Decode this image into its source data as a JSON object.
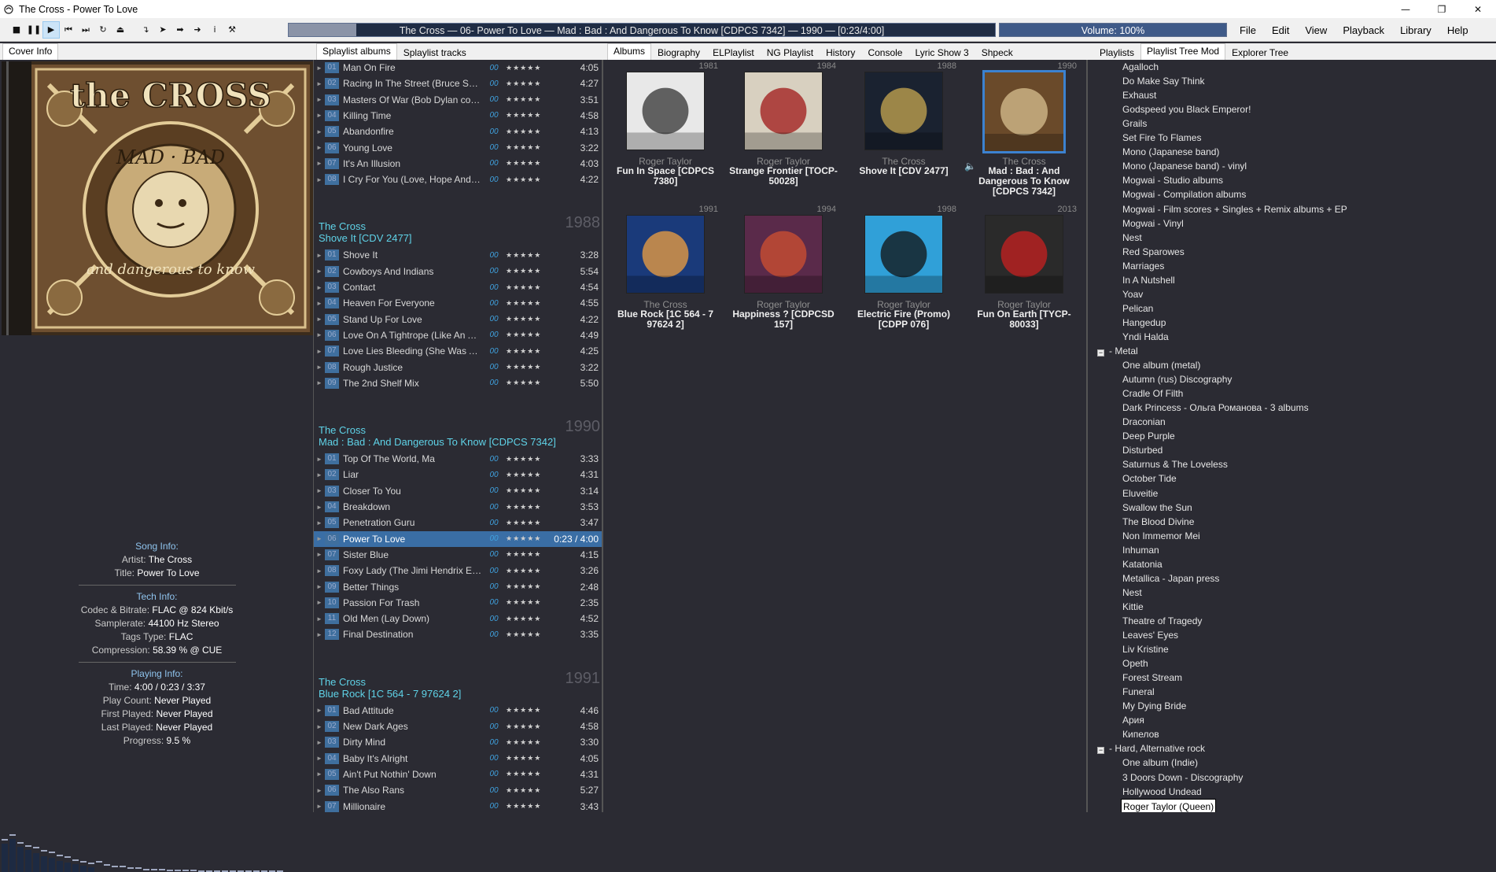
{
  "window": {
    "title": "The Cross - Power To Love"
  },
  "toolbar": {
    "buttons": [
      "stop",
      "pause",
      "play",
      "prev",
      "next",
      "random",
      "eject",
      "a",
      "b",
      "c",
      "d",
      "info",
      "tools"
    ]
  },
  "nowplaying": {
    "text": "The Cross    — 06- Power To Love —    Mad : Bad : And Dangerous To Know [CDPCS 7342] — 1990 —    [0:23/4:00]",
    "progress": 0.096
  },
  "volume": {
    "text": "Volume: 100%",
    "level": 1.0
  },
  "menu": [
    "File",
    "Edit",
    "View",
    "Playback",
    "Library",
    "Help"
  ],
  "left_tabs": [
    "Cover Info"
  ],
  "playlist_tabs": [
    "Splaylist albums",
    "Splaylist tracks"
  ],
  "album_tabs": [
    "Albums",
    "Biography",
    "ELPlaylist",
    "NG Playlist",
    "History",
    "Console",
    "Lyric Show 3",
    "Shpeck"
  ],
  "tree_tabs": [
    "Playlists",
    "Playlist Tree Mod",
    "Explorer Tree"
  ],
  "cover": {
    "band": "the CROSS",
    "subtitle_1": "MAD · BAD",
    "subtitle_2": "and dangerous to know"
  },
  "songinfo": {
    "song_header": "Song Info:",
    "artist_label": "Artist:",
    "artist": "The Cross",
    "title_label": "Title:",
    "title": "Power To Love",
    "tech_header": "Tech Info:",
    "codec_label": "Codec & Bitrate:",
    "codec": "FLAC @ 824 Kbit/s",
    "samplerate_label": "Samplerate:",
    "samplerate": "44100 Hz Stereo",
    "tags_label": "Tags Type:",
    "tags": "FLAC",
    "compression_label": "Compression:",
    "compression": "58.39 % @ CUE",
    "playing_header": "Playing Info:",
    "time_label": "Time:",
    "time": "4:00 / 0:23 / 3:37",
    "playcount_label": "Play Count:",
    "playcount": "Never Played",
    "first_label": "First Played:",
    "first": "Never Played",
    "last_label": "Last Played:",
    "last": "Never Played",
    "progress_label": "Progress:",
    "progress": "9.5 %"
  },
  "playlist": {
    "rating": "★★★★★",
    "oo": "00",
    "groups": [
      {
        "artist": "",
        "album": "",
        "year": "",
        "tracks": [
          {
            "n": "01",
            "t": "Man On Fire",
            "d": "4:05"
          },
          {
            "n": "02",
            "t": "Racing In The Street (Bruce Spri...",
            "d": "4:27"
          },
          {
            "n": "03",
            "t": "Masters Of War (Bob Dylan cover)",
            "d": "3:51"
          },
          {
            "n": "04",
            "t": "Killing Time",
            "d": "4:58"
          },
          {
            "n": "05",
            "t": "Abandonfire",
            "d": "4:13"
          },
          {
            "n": "06",
            "t": "Young Love",
            "d": "3:22"
          },
          {
            "n": "07",
            "t": "It's An Illusion",
            "d": "4:03"
          },
          {
            "n": "08",
            "t": "I Cry For You (Love, Hope And C...",
            "d": "4:22"
          }
        ]
      },
      {
        "artist": "The Cross",
        "album": "Shove It [CDV 2477]",
        "year": "1988",
        "tracks": [
          {
            "n": "01",
            "t": "Shove It",
            "d": "3:28"
          },
          {
            "n": "02",
            "t": "Cowboys And Indians",
            "d": "5:54"
          },
          {
            "n": "03",
            "t": "Contact",
            "d": "4:54"
          },
          {
            "n": "04",
            "t": "Heaven For Everyone",
            "d": "4:55"
          },
          {
            "n": "05",
            "t": "Stand Up For Love",
            "d": "4:22"
          },
          {
            "n": "06",
            "t": "Love On A Tightrope (Like An An...",
            "d": "4:49"
          },
          {
            "n": "07",
            "t": "Love Lies Bleeding (She Was A...",
            "d": "4:25"
          },
          {
            "n": "08",
            "t": "Rough Justice",
            "d": "3:22"
          },
          {
            "n": "09",
            "t": "The 2nd Shelf Mix",
            "d": "5:50"
          }
        ]
      },
      {
        "artist": "The Cross",
        "album": "Mad : Bad : And Dangerous To Know [CDPCS 7342]",
        "year": "1990",
        "tracks": [
          {
            "n": "01",
            "t": "Top Of The World, Ma",
            "d": "3:33"
          },
          {
            "n": "02",
            "t": "Liar",
            "d": "4:31"
          },
          {
            "n": "03",
            "t": "Closer To You",
            "d": "3:14"
          },
          {
            "n": "04",
            "t": "Breakdown",
            "d": "3:53"
          },
          {
            "n": "05",
            "t": "Penetration Guru",
            "d": "3:47"
          },
          {
            "n": "06",
            "t": "Power To Love",
            "d": "0:23 / 4:00",
            "sel": true
          },
          {
            "n": "07",
            "t": "Sister Blue",
            "d": "4:15"
          },
          {
            "n": "08",
            "t": "Foxy Lady (The Jimi Hendrix Exp...",
            "d": "3:26"
          },
          {
            "n": "09",
            "t": "Better Things",
            "d": "2:48"
          },
          {
            "n": "10",
            "t": "Passion For Trash",
            "d": "2:35"
          },
          {
            "n": "11",
            "t": "Old Men (Lay Down)",
            "d": "4:52"
          },
          {
            "n": "12",
            "t": "Final Destination",
            "d": "3:35"
          }
        ]
      },
      {
        "artist": "The Cross",
        "album": "Blue Rock [1C 564 - 7 97624 2]",
        "year": "1991",
        "tracks": [
          {
            "n": "01",
            "t": "Bad Attitude",
            "d": "4:46"
          },
          {
            "n": "02",
            "t": "New Dark Ages",
            "d": "4:58"
          },
          {
            "n": "03",
            "t": "Dirty Mind",
            "d": "3:30"
          },
          {
            "n": "04",
            "t": "Baby It's Alright",
            "d": "4:05"
          },
          {
            "n": "05",
            "t": "Ain't Put Nothin' Down",
            "d": "4:31"
          },
          {
            "n": "06",
            "t": "The Also Rans",
            "d": "5:27"
          },
          {
            "n": "07",
            "t": "Millionaire",
            "d": "3:43"
          }
        ]
      }
    ]
  },
  "albums": [
    {
      "year": "1981",
      "artist": "Roger Taylor",
      "name": "Fun In Space [CDPCS 7380]",
      "color": "#e8e8e8",
      "accent": "#333"
    },
    {
      "year": "1984",
      "artist": "Roger Taylor",
      "name": "Strange Frontier [TOCP-50028]",
      "color": "#d8d0c0",
      "accent": "#a01818"
    },
    {
      "year": "1988",
      "artist": "The Cross",
      "name": "Shove It [CDV 2477]",
      "color": "#1a2230",
      "accent": "#c8a850"
    },
    {
      "year": "1990",
      "artist": "The Cross",
      "name": "Mad : Bad : And Dangerous To Know [CDPCS 7342]",
      "color": "#6a4a2a",
      "accent": "#d8c090",
      "sel": true
    },
    {
      "year": "1991",
      "artist": "The Cross",
      "name": "Blue Rock [1C 564 - 7 97624 2]",
      "color": "#1a3a7a",
      "accent": "#f0a040"
    },
    {
      "year": "1994",
      "artist": "Roger Taylor",
      "name": "Happiness ? [CDPCSD 157]",
      "color": "#5a2a4a",
      "accent": "#d05030"
    },
    {
      "year": "1998",
      "artist": "Roger Taylor",
      "name": "Electric Fire (Promo) [CDPP 076]",
      "color": "#30a0d8",
      "accent": "#111"
    },
    {
      "year": "2013",
      "artist": "Roger Taylor",
      "name": "Fun On Earth [TYCP-80033]",
      "color": "#2a2a2a",
      "accent": "#c82020"
    }
  ],
  "tree": [
    {
      "t": "Agalloch"
    },
    {
      "t": "Do Make Say Think"
    },
    {
      "t": "Exhaust"
    },
    {
      "t": "Godspeed you Black Emperor!"
    },
    {
      "t": "Grails"
    },
    {
      "t": "Set Fire To Flames"
    },
    {
      "t": "Mono (Japanese band)"
    },
    {
      "t": "Mono (Japanese band) - vinyl"
    },
    {
      "t": "Mogwai - Studio albums"
    },
    {
      "t": "Mogwai - Compilation albums"
    },
    {
      "t": "Mogwai - Film scores + Singles + Remix albums + EP"
    },
    {
      "t": "Mogwai - Vinyl"
    },
    {
      "t": "Nest"
    },
    {
      "t": "Red Sparowes"
    },
    {
      "t": "Marriages"
    },
    {
      "t": "In A Nutshell"
    },
    {
      "t": "Yoav"
    },
    {
      "t": "Pelican"
    },
    {
      "t": "Hangedup"
    },
    {
      "t": "Yndi Halda"
    },
    {
      "t": "- Metal",
      "cat": true
    },
    {
      "t": "One album (metal)"
    },
    {
      "t": "Autumn (rus) Discography"
    },
    {
      "t": "Cradle Of Filth"
    },
    {
      "t": "Dark Princess  -  Ольга Романова  -  3 albums"
    },
    {
      "t": "Draconian"
    },
    {
      "t": "Deep Purple"
    },
    {
      "t": "Disturbed"
    },
    {
      "t": "Saturnus  &  The Loveless"
    },
    {
      "t": "October Tide"
    },
    {
      "t": "Eluveitie"
    },
    {
      "t": "Swallow the Sun"
    },
    {
      "t": "The Blood Divine"
    },
    {
      "t": "Non Immemor Mei"
    },
    {
      "t": "Inhuman"
    },
    {
      "t": "Katatonia"
    },
    {
      "t": "Metallica - Japan press"
    },
    {
      "t": "Nest"
    },
    {
      "t": "Kittie"
    },
    {
      "t": "Theatre of Tragedy"
    },
    {
      "t": "Leaves' Eyes"
    },
    {
      "t": "Liv Kristine"
    },
    {
      "t": "Opeth"
    },
    {
      "t": "Forest Stream"
    },
    {
      "t": "Funeral"
    },
    {
      "t": "My Dying Bride"
    },
    {
      "t": "Ария"
    },
    {
      "t": "Кипелов"
    },
    {
      "t": "- Hard, Alternative rock",
      "cat": true
    },
    {
      "t": "One album (Indie)"
    },
    {
      "t": "3 Doors Down - Discography"
    },
    {
      "t": "Hollywood Undead"
    },
    {
      "t": "Roger Taylor (Queen)",
      "selected": true
    }
  ]
}
